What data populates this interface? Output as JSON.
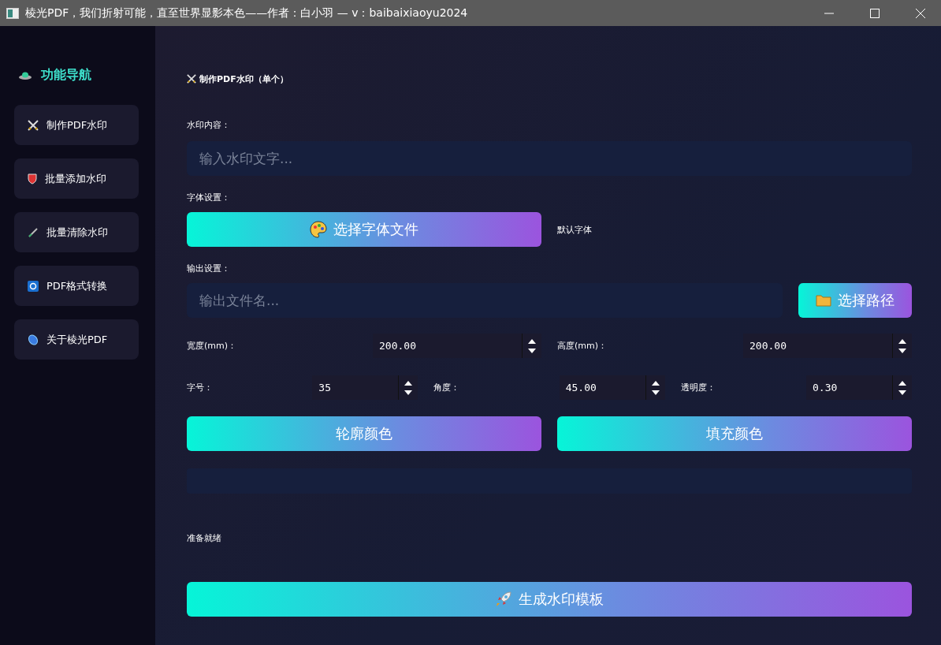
{
  "window": {
    "title": "棱光PDF，我们折射可能，直至世界显影本色——作者：白小羽 — v：baibaixiaoyu2024"
  },
  "sidebar": {
    "heading": "功能导航",
    "items": [
      {
        "label": "制作PDF水印"
      },
      {
        "label": "批量添加水印"
      },
      {
        "label": "批量清除水印"
      },
      {
        "label": "PDF格式转换"
      },
      {
        "label": "关于棱光PDF"
      }
    ]
  },
  "main": {
    "section_title": "制作PDF水印（单个）",
    "watermark_label": "水印内容：",
    "watermark_field": {
      "placeholder": "输入水印文字..."
    },
    "font_label": "字体设置：",
    "font_button": "选择字体文件",
    "font_status": "默认字体",
    "output_label": "输出设置：",
    "output_field": {
      "placeholder": "输出文件名..."
    },
    "path_button": "选择路径",
    "spin_rows": [
      [
        {
          "label": "宽度(mm)：",
          "value": "200.00"
        },
        {
          "label": "高度(mm)：",
          "value": "200.00"
        }
      ],
      [
        {
          "label": "字号：",
          "value": "35"
        },
        {
          "label": "角度：",
          "value": "45.00"
        },
        {
          "label": "透明度：",
          "value": "0.30"
        }
      ]
    ],
    "color_buttons": [
      "轮廓颜色",
      "填充颜色"
    ],
    "progress": {
      "level": 0
    },
    "status": "准备就绪",
    "generate_button": "生成水印模板"
  }
}
